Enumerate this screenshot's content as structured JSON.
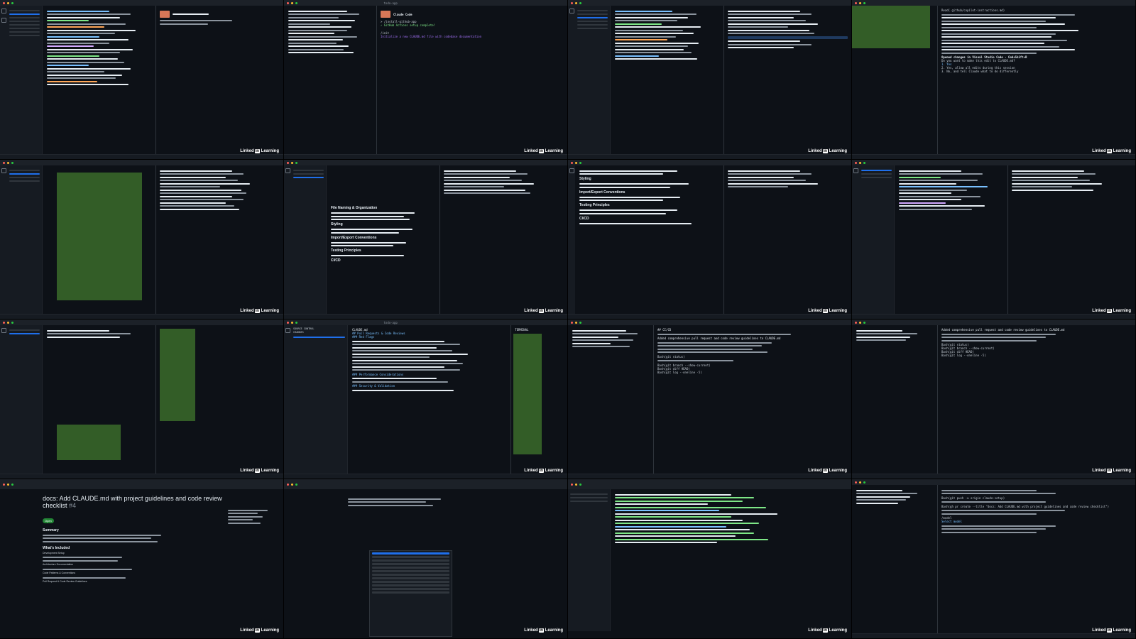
{
  "watermark": {
    "brand": "Linked",
    "brand_suffix": "in",
    "product": " Learning"
  },
  "windows": {
    "title_todo": "todo-app",
    "claude_md_tab": "CLAUDE.md",
    "terminal_tab": "TERMINAL",
    "source_control": "SOURCE CONTROL",
    "changes": "CHANGES"
  },
  "tile2": {
    "product": "Claude Code",
    "install_cmd": "> /install-github-app",
    "install_done": "✓ GitHub Actions setup complete!",
    "init_cmd": "/init",
    "init_desc": "Initialize a new CLAUDE.md file with codebase documentation"
  },
  "tile4": {
    "search_result": "Read(.github/copilot-instructions.md)",
    "summary": "Opened changes in Visual Studio Code - Cmd+Shift+R",
    "question": "Do you want to make this edit to CLAUDE.md?",
    "option1": "1. Yes",
    "option2": "2. Yes, allow all edits during this session",
    "option3": "3. No, and tell Claude what to do differently"
  },
  "tile6": {
    "h1": "File Naming & Organization",
    "h2": "Styling",
    "h3": "Import/Export Conventions",
    "h4": "Testing Principles",
    "h5": "CI/CD"
  },
  "tile10": {
    "h1": "## Pull Requests & Code Reviews",
    "h2": "### Red Flags",
    "h3": "### Performance Considerations",
    "h4": "### Security & Validation"
  },
  "tile11": {
    "ci": "## CI/CD",
    "added": "Added comprehensive pull request and code review guidelines to CLAUDE.md",
    "git1": "Bash(git status)",
    "git2": "Bash(git branch --show-current)",
    "git3": "Bash(git diff HEAD)",
    "git4": "Bash(git log --oneline -5)"
  },
  "tile13": {
    "title": "docs: Add CLAUDE.md with project guidelines and code review checklist",
    "number": "#4",
    "state": "Open",
    "summary": "Summary",
    "included": "What's Included",
    "dev_setup": "Development Setup",
    "arch": "Architecture Documentation",
    "code_patterns": "Code Patterns & Conventions",
    "pr_review": "Pull Request & Code Review Guidelines"
  },
  "tile16": {
    "git_push": "Bash(git push -u origin claude-setup)",
    "gh_pr": "Bash(gh pr create --title \"docs: Add CLAUDE.md with project guidelines and code review checklist\")",
    "model": "/model",
    "select_model": "Select model"
  }
}
